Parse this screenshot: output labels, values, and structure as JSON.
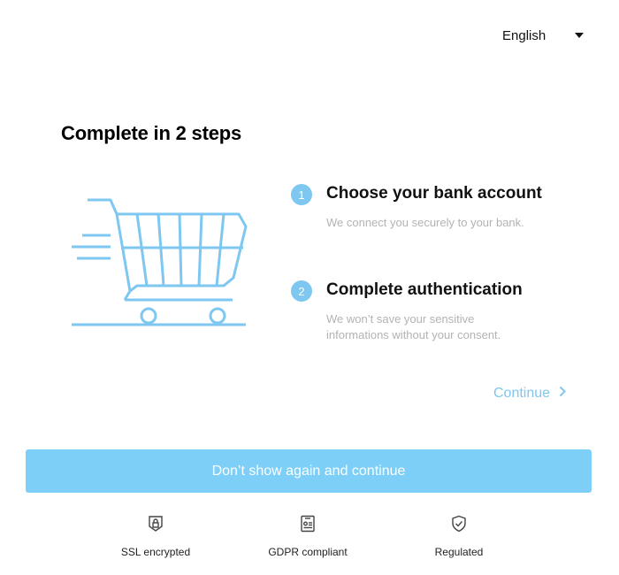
{
  "header": {
    "language": "English",
    "language_caret_icon": "caret-down-icon"
  },
  "main": {
    "title": "Complete in 2 steps",
    "illustration_icon": "shopping-cart-icon",
    "steps": [
      {
        "number": "1",
        "title": "Choose your bank account",
        "description": "We connect you securely to your bank."
      },
      {
        "number": "2",
        "title": "Complete authentication",
        "description_line1": "We won’t save your sensitive",
        "description_line2": "informations without your consent."
      }
    ],
    "continue_label": "Continue",
    "continue_icon": "chevron-right-icon"
  },
  "footer": {
    "primary_button": "Don’t show again and continue",
    "badges": [
      {
        "label": "SSL encrypted",
        "icon": "lock-badge-icon"
      },
      {
        "label": "GDPR compliant",
        "icon": "id-card-icon"
      },
      {
        "label": "Regulated",
        "icon": "shield-check-icon"
      }
    ]
  },
  "colors": {
    "accent": "#7ec7f0",
    "button": "#7dcff8",
    "muted_text": "#b3b3b3"
  }
}
